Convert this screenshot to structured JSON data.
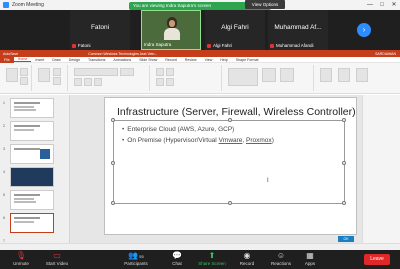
{
  "window": {
    "title": "Zoom Meeting",
    "controls": [
      "—",
      "□",
      "✕"
    ]
  },
  "share_banner": {
    "text": "You are viewing Indra Saputra's screen",
    "view_options": "View Options"
  },
  "participants": [
    {
      "name": "Fatoni",
      "big_name": "Fatoni"
    },
    {
      "name": "Indra Saputra"
    },
    {
      "name": "Algi Fahri",
      "big_name": "Algi Fahri"
    },
    {
      "name": "Muhammad Afandi",
      "big_name": "Muhammad Af..."
    }
  ],
  "screen": {
    "ppt_titlebar": {
      "left": "AutoSave",
      "center": "Common Windows Technologies Asst Vetn...",
      "right": "SARDIAWAN"
    },
    "ppt_tabs": [
      "File",
      "Home",
      "Insert",
      "Draw",
      "Design",
      "Transitions",
      "Animations",
      "Slide Show",
      "Record",
      "Review",
      "View",
      "Help",
      "Shape Format"
    ],
    "slide": {
      "title": "Infrastructure (Server, Firewall, Wireless Controller)",
      "bullet1": "Enterprise Cloud (AWS, Azure, GCP)",
      "bullet2_prefix": "On Premise (Hypervisor/Virtual ",
      "bullet2_vmware": "Vmware",
      "bullet2_mid": ", ",
      "bullet2_proxmox": "Proxmox",
      "bullet2_suffix": ")",
      "cursor_mark": "I"
    },
    "thumb_numbers": [
      "1",
      "2",
      "3",
      "4",
      "5",
      "6",
      "7"
    ],
    "status_tag": "OK"
  },
  "toolbar": [
    {
      "id": "unmute",
      "label": "Unmute",
      "icon": "mic-muted-icon"
    },
    {
      "id": "start-video",
      "label": "Start Video",
      "icon": "video-off-icon"
    },
    {
      "id": "participants",
      "label": "Participants",
      "icon": "people-icon",
      "count": "55"
    },
    {
      "id": "chat",
      "label": "Chat",
      "icon": "chat-icon"
    },
    {
      "id": "share-screen",
      "label": "Share Screen",
      "icon": "share-screen-icon"
    },
    {
      "id": "record",
      "label": "Record",
      "icon": "record-icon"
    },
    {
      "id": "reactions",
      "label": "Reactions",
      "icon": "reactions-icon"
    },
    {
      "id": "apps",
      "label": "Apps",
      "icon": "apps-icon"
    }
  ],
  "leave_label": "Leave",
  "colors": {
    "zoom_blue": "#2d8cff",
    "ppt_red": "#c43e1c",
    "leave_red": "#e02828",
    "share_green": "#33c45d"
  }
}
